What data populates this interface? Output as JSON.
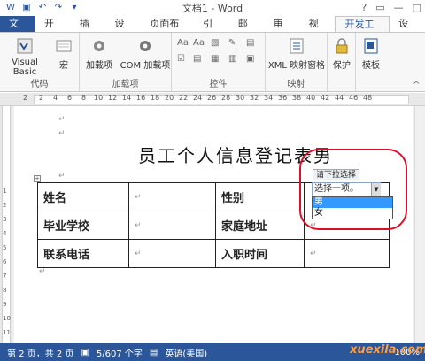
{
  "window": {
    "title": "文档1 - Word"
  },
  "tabs": [
    "文件",
    "开始",
    "插入",
    "设计",
    "页面布局",
    "引用",
    "邮件",
    "审阅",
    "视图",
    "开发工具",
    "设计"
  ],
  "ribbon": {
    "code": {
      "label": "代码",
      "visual_basic": "Visual Basic",
      "macro": "宏"
    },
    "addins": {
      "label": "加载项",
      "addin": "加载项",
      "com_addin": "COM 加载项"
    },
    "controls": {
      "label": "控件"
    },
    "mapping": {
      "label": "映射",
      "xml_pane": "XML 映射窗格"
    },
    "protect": {
      "label": "保护"
    },
    "template": {
      "label": "模板"
    }
  },
  "ruler": [
    "2",
    "2",
    "4",
    "6",
    "8",
    "10",
    "12",
    "14",
    "16",
    "18",
    "20",
    "22",
    "24",
    "26",
    "28",
    "30",
    "32",
    "34",
    "36",
    "38",
    "40",
    "42",
    "44",
    "46",
    "48"
  ],
  "vruler": [
    "1",
    "2",
    "3",
    "4",
    "5",
    "6",
    "7",
    "8",
    "9",
    "10",
    "11"
  ],
  "document": {
    "title": "员工个人信息登记表男",
    "table": [
      [
        "姓名",
        "",
        "性别",
        ""
      ],
      [
        "毕业学校",
        "",
        "家庭地址",
        ""
      ],
      [
        "联系电话",
        "",
        "入职时间",
        ""
      ]
    ],
    "control": {
      "tag": "请下拉选择",
      "placeholder": "选择一项。",
      "options": [
        "男",
        "女"
      ]
    }
  },
  "status": {
    "page": "第 2 页，共 2 页",
    "words": "5/607 个字",
    "lang": "英语(美国)",
    "zoom": "100%"
  },
  "watermark": "xuexila.com"
}
